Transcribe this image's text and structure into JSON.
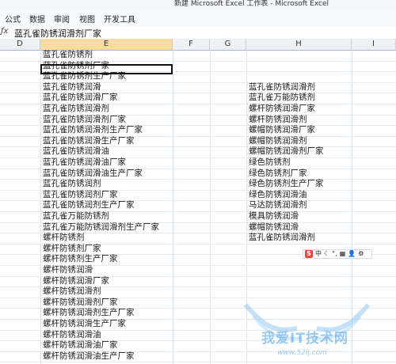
{
  "window": {
    "title": "新建 Microsoft Excel 工作表 - Microsoft Excel"
  },
  "ribbon": {
    "tabs": [
      "公式",
      "数据",
      "审阅",
      "视图",
      "开发工具"
    ]
  },
  "formula_bar": {
    "icon": "fx-icon",
    "value": "蓝孔雀防锈润滑剂厂家"
  },
  "columns": [
    "D",
    "E",
    "F",
    "G",
    "H",
    "I"
  ],
  "active_column": "E",
  "column_e": [
    "蓝孔雀防锈剂",
    "蓝孔雀防锈剂厂家",
    "蓝孔雀防锈剂生产厂家",
    "蓝孔雀防锈润滑",
    "蓝孔雀防锈润滑厂家",
    "蓝孔雀防锈润滑剂",
    "蓝孔雀防锈润滑剂厂家",
    "蓝孔雀防锈润滑剂生产厂家",
    "蓝孔雀防锈润滑生产厂家",
    "蓝孔雀防锈润滑油",
    "蓝孔雀防锈润滑油厂家",
    "蓝孔雀防锈润滑油生产厂家",
    "蓝孔雀防锈润剂",
    "蓝孔雀防锈润剂厂家",
    "蓝孔雀防锈润剂生产厂家",
    "蓝孔雀万能防锈剂",
    "蓝孔雀万能防锈润滑剂生产厂家",
    "螺杆防锈剂",
    "螺杆防锈剂厂家",
    "螺杆防锈剂生产厂家",
    "螺杆防锈润滑",
    "螺杆防锈润滑厂家",
    "螺杆防锈润滑剂",
    "螺杆防锈润滑剂厂家",
    "螺杆防锈润滑剂生产厂家",
    "螺杆防锈润滑生产厂家",
    "螺杆防锈润滑油",
    "螺杆防锈润滑油厂家",
    "螺杆防锈润滑油生产厂家"
  ],
  "column_h": [
    "",
    "",
    "",
    "蓝孔雀防锈润滑剂",
    "蓝孔雀万能防锈剂",
    "螺杆防锈润滑厂家",
    "螺杆防锈润滑剂",
    "螺帽防锈润滑厂家",
    "螺帽防锈润滑剂",
    "螺帽防锈润滑剂厂家",
    "绿色防锈剂",
    "绿色防锈剂厂家",
    "绿色防锈剂生产厂家",
    "绿色防锈润滑油",
    "马达防锈润滑剂",
    "模具防锈润滑",
    "螺帽防锈润滑",
    "蓝孔雀防锈润滑剂"
  ],
  "ime_toolbar": {
    "mode": "中",
    "logo": "S"
  },
  "watermark": {
    "text": "我爱IT技术网",
    "url": "www.52ij.com"
  }
}
